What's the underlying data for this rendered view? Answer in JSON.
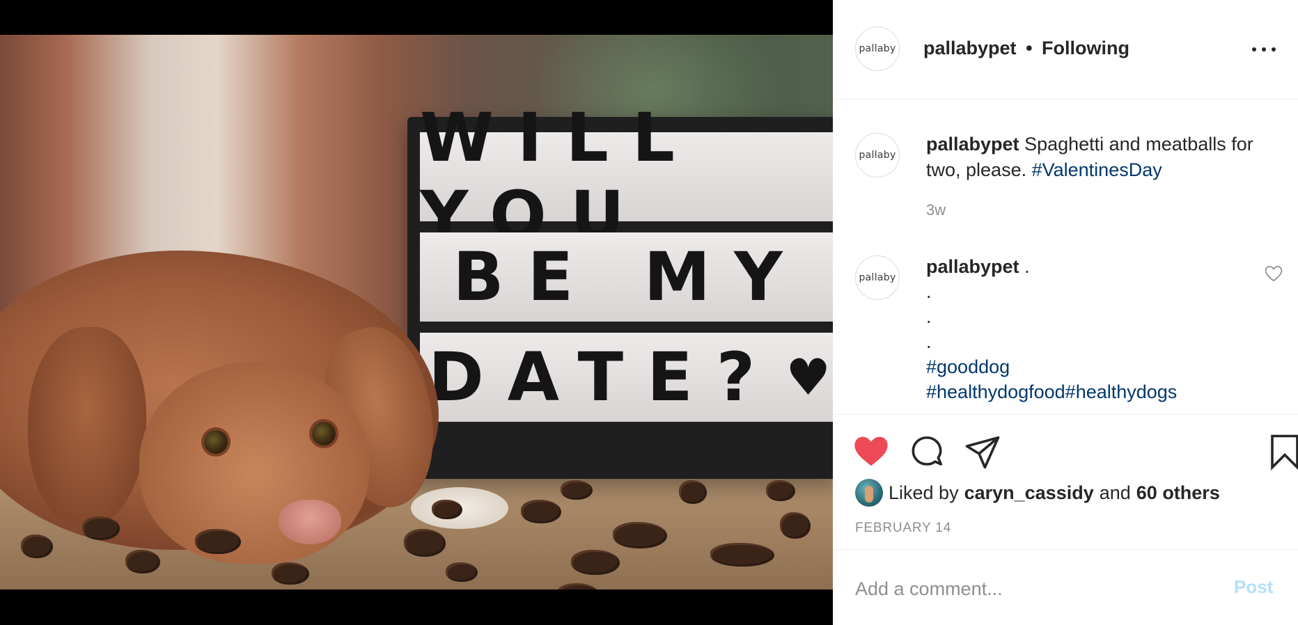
{
  "post": {
    "username": "pallabypet",
    "separator": "•",
    "follow_status": "Following",
    "avatar_text": "pallaby",
    "more_icon": "more-horizontal-icon"
  },
  "photo": {
    "sign_lines": [
      "WILL YOU",
      "BE MY",
      "DATE?"
    ],
    "sign_heart": "♥"
  },
  "caption": {
    "username": "pallabypet",
    "text": "Spaghetti and meatballs for two, please.",
    "hashtag": "#ValentinesDay",
    "time": "3w"
  },
  "comment": {
    "username": "pallabypet",
    "first_line": ".",
    "lines": [
      ".",
      ".",
      "."
    ],
    "hashtag_line1": "#gooddog",
    "hashtag_line2": "#healthydogfood#healthydogs"
  },
  "actions": {
    "liked": true,
    "like_color": "#ed4956",
    "icons": [
      "heart-filled-icon",
      "comment-icon",
      "share-icon",
      "bookmark-icon"
    ]
  },
  "likes": {
    "prefix": "Liked by",
    "user": "caryn_cassidy",
    "connector": "and",
    "others": "60 others"
  },
  "date": "FEBRUARY 14",
  "add_comment": {
    "placeholder": "Add a comment...",
    "post_label": "Post",
    "post_color": "#b2dffc"
  }
}
